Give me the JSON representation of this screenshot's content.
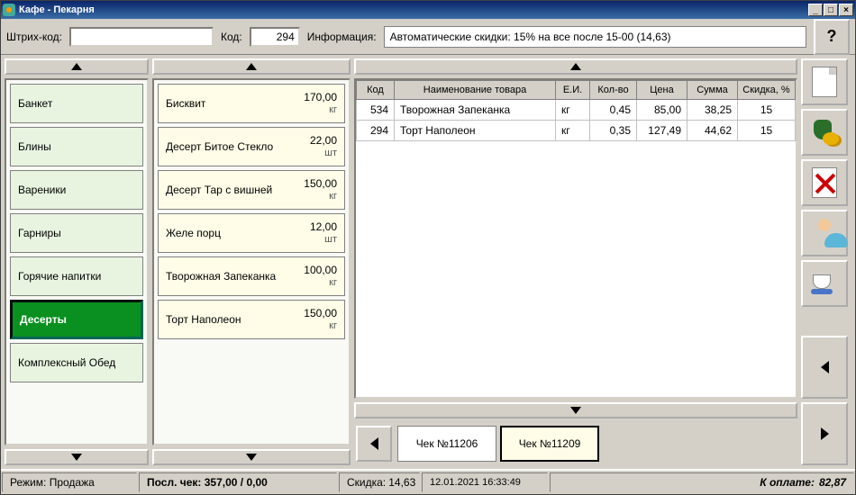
{
  "window": {
    "title": "Кафе - Пекарня"
  },
  "toolbar": {
    "barcode_label": "Штрих-код:",
    "barcode_value": "",
    "code_label": "Код:",
    "code_value": "294",
    "info_label": "Информация:",
    "info_text": "Автоматические скидки: 15% на все после 15-00 (14,63)",
    "help": "?"
  },
  "categories": [
    {
      "label": "Банкет",
      "active": false
    },
    {
      "label": "Блины",
      "active": false
    },
    {
      "label": "Вареники",
      "active": false
    },
    {
      "label": "Гарниры",
      "active": false
    },
    {
      "label": "Горячие напитки",
      "active": false
    },
    {
      "label": "Десерты",
      "active": true
    },
    {
      "label": "Комплексный Обед",
      "active": false
    }
  ],
  "products": [
    {
      "name": "Бисквит",
      "price": "170,00",
      "unit": "кг"
    },
    {
      "name": "Десерт Битое Стекло",
      "price": "22,00",
      "unit": "шт"
    },
    {
      "name": "Десерт Тар с вишней",
      "price": "150,00",
      "unit": "кг"
    },
    {
      "name": "Желе порц",
      "price": "12,00",
      "unit": "шт"
    },
    {
      "name": "Творожная Запеканка",
      "price": "100,00",
      "unit": "кг"
    },
    {
      "name": "Торт Наполеон",
      "price": "150,00",
      "unit": "кг"
    }
  ],
  "receipt": {
    "headers": {
      "code": "Код",
      "name": "Наименование товара",
      "unit": "Е.И.",
      "qty": "Кол-во",
      "price": "Цена",
      "sum": "Сумма",
      "disc": "Скидка, %"
    },
    "rows": [
      {
        "code": "534",
        "name": "Творожная Запеканка",
        "unit": "кг",
        "qty": "0,45",
        "price": "85,00",
        "sum": "38,25",
        "disc": "15"
      },
      {
        "code": "294",
        "name": "Торт Наполеон",
        "unit": "кг",
        "qty": "0,35",
        "price": "127,49",
        "sum": "44,62",
        "disc": "15"
      }
    ]
  },
  "tabs": [
    {
      "label": "Чек №11206",
      "active": false
    },
    {
      "label": "Чек №11209",
      "active": true
    }
  ],
  "status": {
    "mode_label": "Режим:",
    "mode_value": "Продажа",
    "last_label": "Посл. чек:",
    "last_value": "357,00 / 0,00",
    "discount_label": "Скидка:",
    "discount_value": "14,63",
    "datetime": "12.01.2021 16:33:49",
    "total_label": "К оплате:",
    "total_value": "82,87"
  }
}
